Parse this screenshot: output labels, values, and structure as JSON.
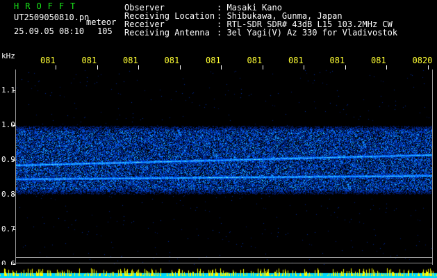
{
  "app": {
    "title": "HROFFT"
  },
  "file": {
    "name": "UT2509050810.pn",
    "mode": "meteor"
  },
  "session": {
    "datetime": "25.09.05 08:10",
    "count": "105"
  },
  "info": {
    "observer_label": "Observer",
    "observer_value": ": Masaki Kano",
    "location_label": "Receiving Location",
    "location_value": ": Shibukawa, Gunma, Japan",
    "receiver_label": "Receiver",
    "receiver_value": ": RTL-SDR SDR# 43dB L15 103.2MHz CW",
    "antenna_label": "Receiving Antenna",
    "antenna_value": ": 3el Yagi(V) Az 330 for Vladivostok"
  },
  "yaxis": {
    "unit": "kHz",
    "ticks": [
      "1.1",
      "1.0",
      "0.9",
      "0.8",
      "0.7",
      "0.6"
    ]
  },
  "xaxis": {
    "ticks": [
      "081",
      "081",
      "081",
      "081",
      "081",
      "081",
      "081",
      "081",
      "081",
      "0820"
    ]
  },
  "colors": {
    "background": "#000000",
    "text": "#ffffff",
    "title": "#19e619",
    "ticks_x": "#ffff33",
    "spectrum_low": "#000060",
    "spectrum_mid": "#2850ff",
    "spectrum_high": "#a0ffd0",
    "baseline_cyan": "#00d8ff",
    "baseline_yellow": "#ffff00"
  },
  "chart_data": {
    "type": "heatmap",
    "xlabel": "",
    "ylabel": "kHz",
    "ylim": [
      0.6,
      1.15
    ],
    "signal_band": [
      0.8,
      1.0
    ],
    "carriers": [
      {
        "freq_start": 0.885,
        "freq_end": 0.915
      },
      {
        "freq_start": 0.845,
        "freq_end": 0.855
      }
    ],
    "grid": false
  }
}
